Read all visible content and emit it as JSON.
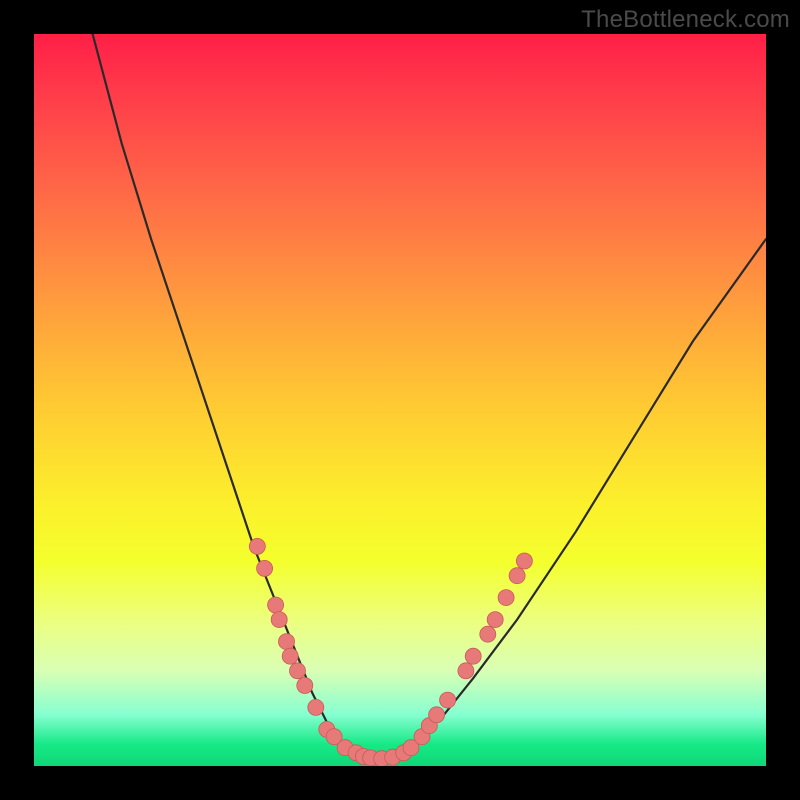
{
  "watermark": "TheBottleneck.com",
  "colors": {
    "frame": "#000000",
    "curve_stroke": "#2a2a2a",
    "point_fill": "#e77a78",
    "point_stroke": "#c95957"
  },
  "chart_data": {
    "type": "line",
    "title": "",
    "xlabel": "",
    "ylabel": "",
    "xlim": [
      0,
      100
    ],
    "ylim": [
      0,
      100
    ],
    "annotations": [
      "TheBottleneck.com"
    ],
    "series": [
      {
        "name": "bottleneck-curve",
        "x": [
          8,
          12,
          16,
          20,
          24,
          28,
          30,
          32,
          34,
          36,
          38,
          40,
          42,
          44,
          46,
          48,
          50,
          52,
          56,
          60,
          66,
          74,
          82,
          90,
          100
        ],
        "y": [
          100,
          85,
          72,
          60,
          48,
          36,
          30,
          25,
          20,
          15,
          10,
          6,
          3,
          1.5,
          1,
          1,
          1.5,
          3,
          7,
          12,
          20,
          32,
          45,
          58,
          72
        ]
      }
    ],
    "points": [
      {
        "x": 30.5,
        "y": 30
      },
      {
        "x": 31.5,
        "y": 27
      },
      {
        "x": 33.0,
        "y": 22
      },
      {
        "x": 33.5,
        "y": 20
      },
      {
        "x": 34.5,
        "y": 17
      },
      {
        "x": 35.0,
        "y": 15
      },
      {
        "x": 36.0,
        "y": 13
      },
      {
        "x": 37.0,
        "y": 11
      },
      {
        "x": 38.5,
        "y": 8
      },
      {
        "x": 40.0,
        "y": 5
      },
      {
        "x": 41.0,
        "y": 4
      },
      {
        "x": 42.5,
        "y": 2.5
      },
      {
        "x": 44.0,
        "y": 1.8
      },
      {
        "x": 45.0,
        "y": 1.3
      },
      {
        "x": 46.0,
        "y": 1.1
      },
      {
        "x": 47.5,
        "y": 1.0
      },
      {
        "x": 49.0,
        "y": 1.2
      },
      {
        "x": 50.5,
        "y": 1.8
      },
      {
        "x": 51.5,
        "y": 2.5
      },
      {
        "x": 53.0,
        "y": 4
      },
      {
        "x": 54.0,
        "y": 5.5
      },
      {
        "x": 55.0,
        "y": 7
      },
      {
        "x": 56.5,
        "y": 9
      },
      {
        "x": 59.0,
        "y": 13
      },
      {
        "x": 60.0,
        "y": 15
      },
      {
        "x": 62.0,
        "y": 18
      },
      {
        "x": 63.0,
        "y": 20
      },
      {
        "x": 64.5,
        "y": 23
      },
      {
        "x": 66.0,
        "y": 26
      },
      {
        "x": 67.0,
        "y": 28
      }
    ]
  }
}
